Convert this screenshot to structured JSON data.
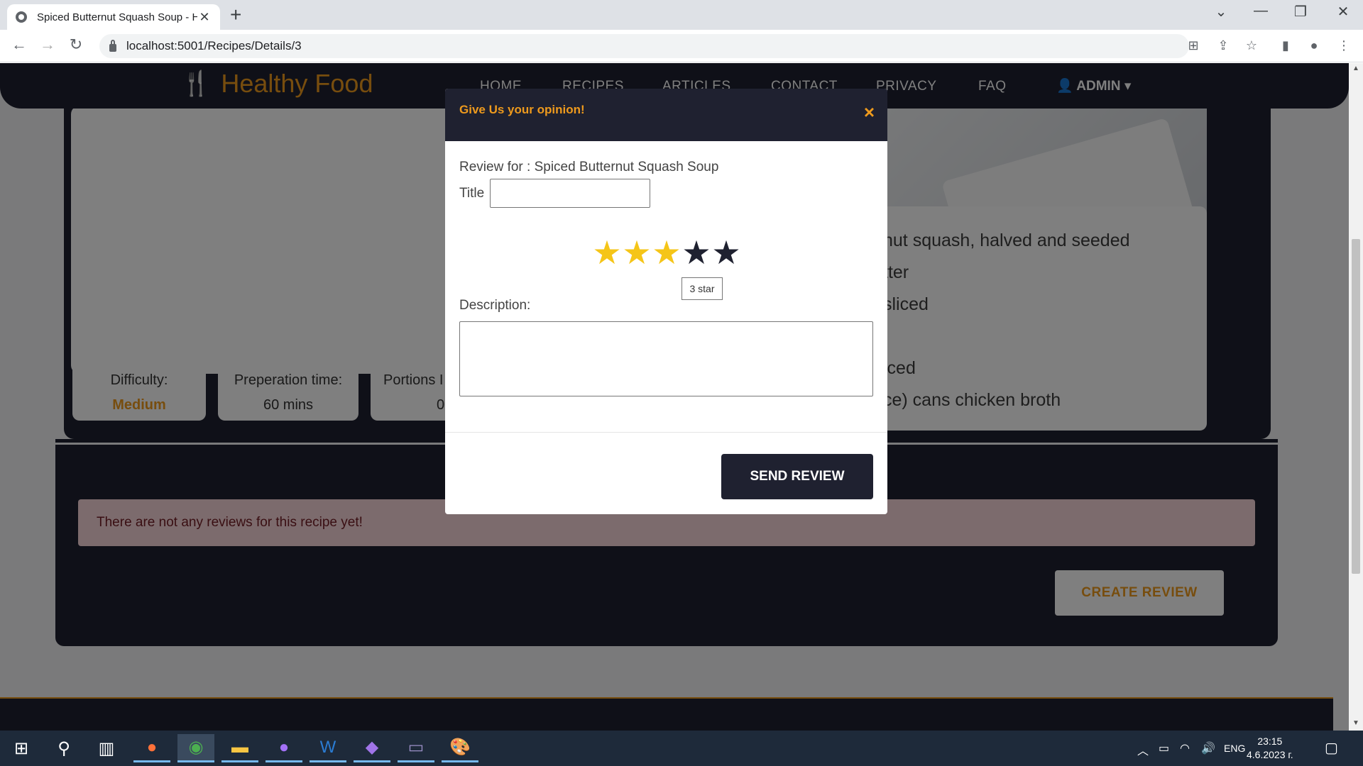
{
  "browser": {
    "tab_title": "Spiced Butternut Squash Soup - H",
    "new_tab": "+",
    "url": "localhost:5001/Recipes/Details/3"
  },
  "site": {
    "brand": "Healthy Food",
    "nav": [
      "HOME",
      "RECIPES",
      "ARTICLES",
      "CONTACT",
      "PRIVACY",
      "FAQ"
    ],
    "user": "ADMIN"
  },
  "recipe": {
    "ingredients": [
      "nut squash, halved and seeded",
      "tter",
      "sliced",
      "",
      "iced",
      "ce) cans chicken broth"
    ],
    "stats": [
      {
        "label": "Difficulty:",
        "value": "Medium"
      },
      {
        "label": "Preperation time:",
        "value": "60 mins"
      },
      {
        "label": "Portions I",
        "value": "0"
      }
    ]
  },
  "reviews": {
    "empty_message": "There are not any reviews for this recipe yet!",
    "create_button": "CREATE REVIEW"
  },
  "modal": {
    "title": "Give Us your opinion!",
    "close": "×",
    "review_for": "Review for : Spiced Butternut Squash Soup",
    "title_label": "Title",
    "title_value": "",
    "rating": 3,
    "max_rating": 5,
    "tooltip": "3 star",
    "description_label": "Description:",
    "description_value": "",
    "send_button": "SEND REVIEW"
  },
  "taskbar": {
    "lang": "ENG",
    "time": "23:15",
    "date": "4.6.2023 г."
  },
  "colors": {
    "accent": "#ee9a1d",
    "dark": "#1f2130",
    "star_filled": "#f5c518",
    "alert_bg": "#f8d7da"
  }
}
